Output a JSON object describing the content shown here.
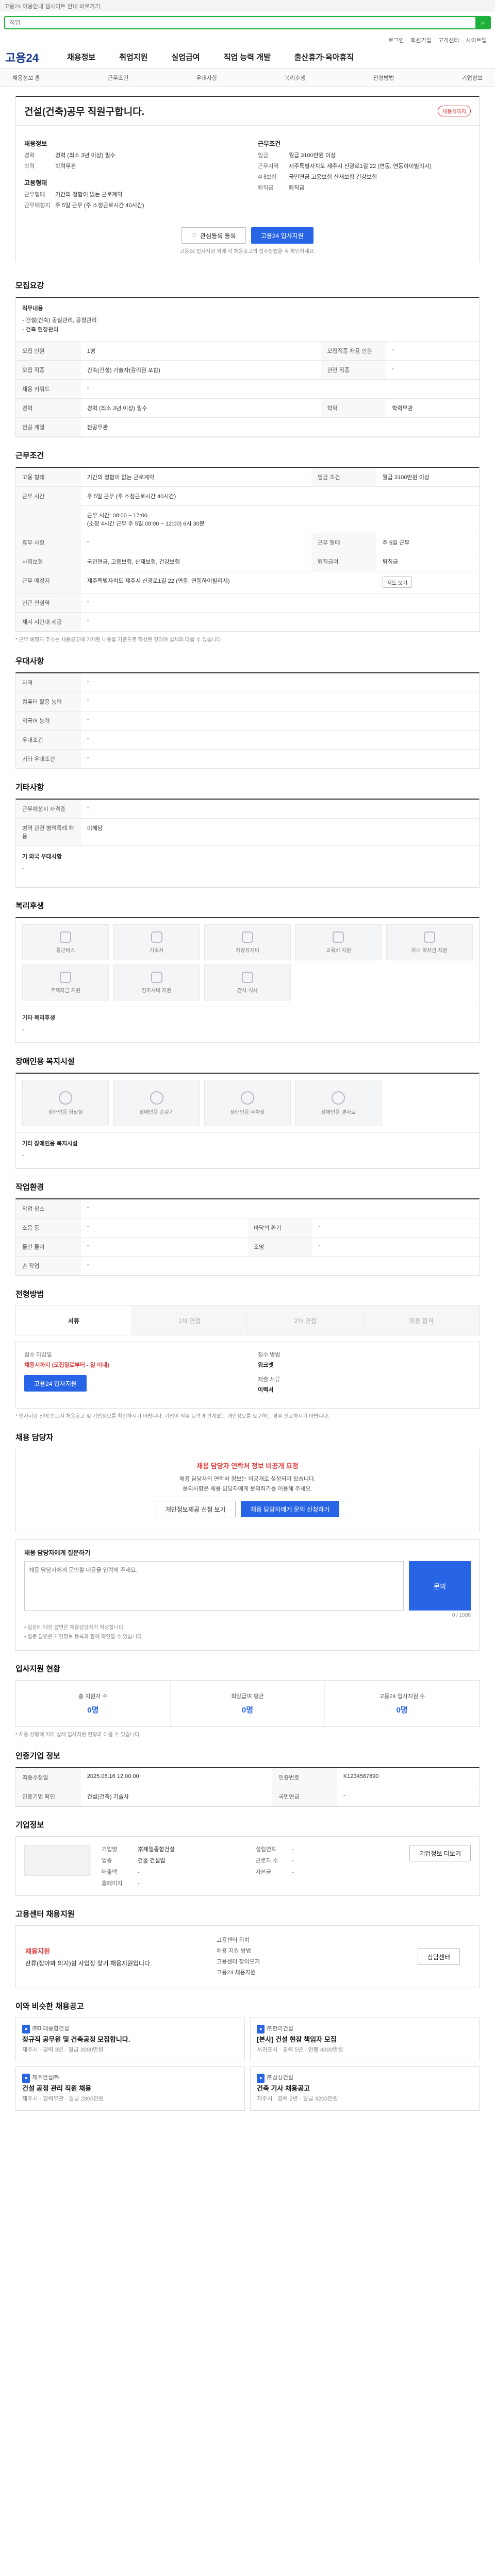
{
  "top_notice": "고용24 이용안내 웹사이트 안내 바로가기",
  "search": {
    "placeholder": "직업",
    "button_label": "검색"
  },
  "util": [
    "로그인",
    "회원가입",
    "고객센터",
    "사이트맵"
  ],
  "logo": "고용24",
  "gnb": [
    "채용정보",
    "취업지원",
    "실업급여",
    "직업 능력 개발",
    "출산휴가·육아휴직"
  ],
  "subnav": [
    "채용정보 홈",
    "근무조건",
    "우대사항",
    "복리후생",
    "전형방법",
    "기업정보"
  ],
  "job": {
    "title": "건설(건축)공무 직원구합니다.",
    "badge": "채용시까지",
    "left_head": "채용정보",
    "left_rows": [
      {
        "k": "경력",
        "v": "경력 (최소 3년 이상) 필수"
      },
      {
        "k": "학력",
        "v": "학력무관"
      },
      {
        "k": "고용형태",
        "v": ""
      },
      {
        "k": "근무형태",
        "v": "기간의 정함이 없는 근로계약"
      },
      {
        "k": "근무예정지",
        "v": "주 5일 근무 (주 소정근로시간 40시간)"
      }
    ],
    "right_head": "근무조건",
    "right_rows": [
      {
        "k": "임금",
        "v": "월급 3100만원 이상"
      },
      {
        "k": "근무지역",
        "v": "제주특별자치도 제주시 신광로1길 22 (연동, 연동하이빌리지)"
      },
      {
        "k": "4대보험",
        "v": "국민연금 고용보험 산재보험 건강보험"
      },
      {
        "k": "퇴직금",
        "v": "퇴직금"
      }
    ],
    "btn_interest": "관심등록 등록",
    "btn_apply": "고용24 입사지원",
    "cta_note": "고용24 입사지원 외에 각 채용공고의 접수방법을 꼭 확인하세요."
  },
  "req": {
    "title": "모집요강",
    "duty_label": "직무내용",
    "duty_text": "- 건설(건축) 공실관리, 공정관리\n- 건축 현장관리",
    "rows": [
      [
        "모집 인원",
        "1명",
        "모집직종 채용 인원",
        "-"
      ],
      [
        "모집 직종",
        "건축(건설) 기술자(감리원 포함)",
        "관련 직종",
        "-"
      ],
      [
        "채용 키워드",
        "-",
        "",
        ""
      ],
      [
        "경력",
        "경력 (최소 3년 이상) 필수",
        "학력",
        "학력무관"
      ],
      [
        "전공 계열",
        "전공무관",
        "",
        ""
      ]
    ]
  },
  "cond": {
    "title": "근무조건",
    "rows": [
      [
        "고용 형태",
        "기간의 정함이 없는 근로계약",
        "임금 조건",
        "월급 3100만원 이상"
      ],
      [
        "근무 시간",
        "주 5일 근무 (주 소정근로시간 40시간)",
        "",
        ""
      ],
      [
        "",
        "근무 시간: 08:00 ~ 17:00\n(소정 4시간 근무 주 5일 08:00 ~ 12:00) 6시 30분",
        "",
        ""
      ],
      [
        "휴무 사항",
        "-",
        "근무 형태",
        "주 5일 근무"
      ],
      [
        "사회보험",
        "국민연금, 고용보험, 산재보험, 건강보험",
        "퇴직급여",
        "퇴직금"
      ],
      [
        "근무 예정지",
        "제주특별자치도 제주시 신광로1길 22 (연동, 연동하이빌리지)",
        "지도 보기",
        ""
      ],
      [
        "인근 전철역",
        "-",
        "",
        ""
      ],
      [
        "채시 시간대 제공",
        "-",
        "",
        ""
      ]
    ],
    "note": "* 근무 예정지 주소는 채용공고에 기재된 내용을 기준으로 작성된 것이며 실제와 다를 수 있습니다."
  },
  "pref": {
    "title": "우대사항",
    "rows": [
      [
        "자격",
        "-"
      ],
      [
        "컴퓨터 활용 능력",
        "-"
      ],
      [
        "외국어 능력",
        "-"
      ],
      [
        "우대조건",
        "-"
      ],
      [
        "기타 우대조건",
        "-"
      ]
    ]
  },
  "extra": {
    "title": "기타사항",
    "rows": [
      [
        "근무예정지 자격증",
        "-"
      ],
      [
        "병역 관련 병역특례 채용",
        "미해당"
      ]
    ],
    "box_label": "기 외국 우대사항",
    "box_text": "-"
  },
  "welfare": {
    "title": "복리후생",
    "items": [
      "통근버스",
      "기숙사",
      "차량유지비",
      "교육비 지원",
      "자녀 학자금 지원",
      "주택자금 지원",
      "경조사비 지원",
      "간식·식사"
    ],
    "etc_label": "기타 복리후생",
    "etc_text": "-"
  },
  "facility": {
    "title": "장애인용 복지시설",
    "items": [
      "장애인용 화장실",
      "장애인용 승강기",
      "장애인용 주차장",
      "장애인용 경사로"
    ],
    "etc_label": "기타 장애인용 복지시설",
    "etc_text": "-"
  },
  "env": {
    "title": "작업환경",
    "rows": [
      [
        "작업 장소",
        "-",
        "",
        ""
      ],
      [
        "소음 등",
        "-",
        "바닥의 환기",
        "-"
      ],
      [
        "물건 들어",
        "-",
        "조명",
        "-"
      ],
      [
        "손 작업",
        "-",
        "",
        ""
      ]
    ]
  },
  "process": {
    "title": "전형방법",
    "steps": [
      "서류",
      "1차 면접",
      "2차 면접",
      "최종 합격"
    ],
    "apply_label": "접수 마감일",
    "apply_value": "채용시까지 (모집일로부터 - 일 이내)",
    "apply_btn": "고용24 입사지원",
    "method_label": "접수 방법",
    "method_value": "워크넷",
    "docs_label": "제출 서류",
    "docs_value": "이력서",
    "notes": "* 입사지원 전에 반드시 채용공고 및 기업정보를 확인하시기 바랍니다. 기업이 직무 능력과 관계없는 개인정보를 요구하는 경우 신고하시기 바랍니다."
  },
  "contact": {
    "title": "채용 담당자",
    "alert_title": "채용 담당자 연락처 정보 비공개 요청",
    "alert_text1": "채용 담당자의 연락처 정보는 비공개로 설정되어 있습니다.",
    "alert_text2": "문의사항은 채용 담당자에게 문의하기를 이용해 주세요.",
    "btn_share": "개인정보제공 신청 보기",
    "btn_ask": "채용 담당자에게 문의 신청하기"
  },
  "ask": {
    "title": "채용 담당자에게 질문하기",
    "placeholder": "채용 담당자에게 문의할 내용을 입력해 주세요.",
    "counter": "0 / 1000",
    "button": "문의",
    "notes": [
      "• 질문에 대한 답변은 채용담당자가 작성합니다.",
      "• 질문 답변은 개인정보 등록과 함께 확인할 수 있습니다."
    ]
  },
  "stats": {
    "title": "입사지원 현황",
    "items": [
      {
        "label": "총 지원자 수",
        "value": "0명"
      },
      {
        "label": "희망급여 평균",
        "value": "0명"
      },
      {
        "label": "고용24 입사지원 수",
        "value": "0명"
      }
    ],
    "note": "* 채용 상황에 따라 실제 입사지원 현황과 다를 수 있습니다."
  },
  "info": {
    "title": "인증기업 정보",
    "rows": [
      [
        "최종수정일",
        "2025.06.16 12:00:00",
        "인증번호",
        "K1234567890"
      ],
      [
        "인증기업 확인",
        "건설(건축) 기술사",
        "국민연금",
        "-"
      ]
    ]
  },
  "company": {
    "title": "기업정보",
    "rows": [
      [
        "기업명",
        "㈜제일종합건설",
        "설립연도",
        "-"
      ],
      [
        "업종",
        "건물 건설업",
        "근로자 수",
        "-"
      ],
      [
        "매출액",
        "-",
        "자본금",
        "-"
      ],
      [
        "홈페이지",
        "-",
        "",
        ""
      ]
    ],
    "btn_more": "기업정보 더보기"
  },
  "consult": {
    "title": "고용센터 채용지원",
    "head": "채용지원",
    "text": "잔류(잡아봐 의지)형 사업장 찾기 채용지원입니다.",
    "items": [
      "고용센터 위치",
      "채용 지원 방법",
      "고용센터 찾아오기",
      "고용24 채용지원"
    ],
    "btn": "상담센터"
  },
  "recs": {
    "title": "이와 비슷한 채용공고",
    "items": [
      {
        "company": "㈜미래종합건설",
        "title": "정규직 공무원 및 건축공정 모집합니다.",
        "meta": "제주시 · 경력 3년 · 월급 3000만원"
      },
      {
        "company": "㈜한라건설",
        "title": "[본사] 건설 현장 책임자 모집",
        "meta": "서귀포시 · 경력 5년 · 연봉 4000만원"
      },
      {
        "company": "제주건설㈜",
        "title": "건설 공정 관리 직원 채용",
        "meta": "제주시 · 경력무관 · 월급 2800만원"
      },
      {
        "company": "㈜삼성건설",
        "title": "건축 기사 채용공고",
        "meta": "제주시 · 경력 2년 · 월급 3200만원"
      }
    ]
  }
}
